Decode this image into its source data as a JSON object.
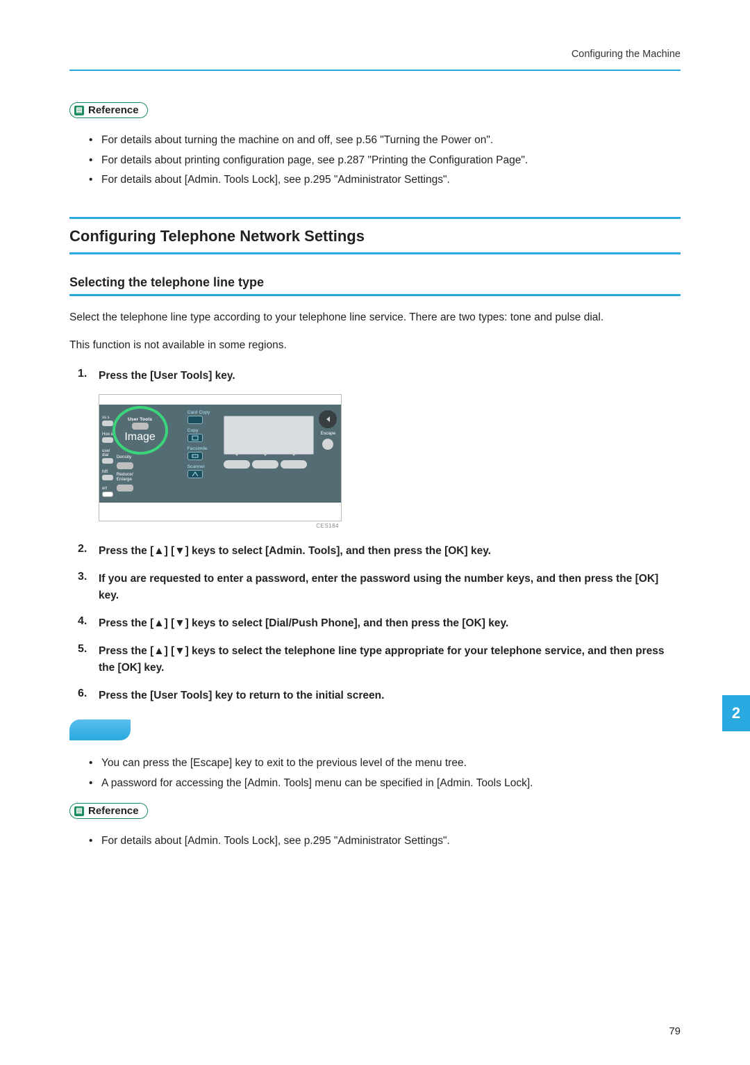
{
  "header": {
    "running": "Configuring the Machine"
  },
  "reference_label": "Reference",
  "ref_list_1": [
    "For details about turning the machine on and off, see p.56 \"Turning the Power on\".",
    "For details about printing configuration page, see p.287 \"Printing the Configuration Page\".",
    "For details about [Admin. Tools Lock], see p.295 \"Administrator Settings\"."
  ],
  "section_heading": "Configuring Telephone Network Settings",
  "sub_heading": "Selecting the telephone line type",
  "para1": "Select the telephone line type according to your telephone line service. There are two types: tone and pulse dial.",
  "para2": "This function is not available in some regions.",
  "steps": [
    {
      "main": "Press the [User Tools] key."
    },
    {
      "main": "Press the [▲] [▼] keys to select [Admin. Tools], and then press the [OK] key."
    },
    {
      "main": "If you are requested to enter a password, enter the password using the number keys, and then press the [OK] key."
    },
    {
      "main": "Press the [▲] [▼] keys to select [Dial/Push Phone], and then press the [OK] key."
    },
    {
      "main": "Press the [▲] [▼] keys to select the telephone line type appropriate for your telephone service, and then press the [OK] key."
    },
    {
      "main": "Press the [User Tools] key to return to the initial screen."
    }
  ],
  "notes": [
    "You can press the [Escape] key to exit to the previous level of the menu tree.",
    "A password for accessing the [Admin. Tools] menu can be specified in [Admin. Tools Lock]."
  ],
  "ref_list_2": [
    "For details about [Admin. Tools Lock], see p.295 \"Administrator Settings\"."
  ],
  "panel": {
    "highlighted": "User Tools",
    "image_sub": "Image",
    "left_labels": [
      "ss s",
      "Hoo ial",
      "use/ dial",
      "hift",
      "ert"
    ],
    "mid_labels": {
      "density": "Density",
      "reduce": "Reduce/\nEnlarge"
    },
    "right_labels": [
      "Card Copy",
      "Copy",
      "Facsimile",
      "Scanner"
    ],
    "escape": "Escape",
    "caption": "CES184"
  },
  "page_number": "79",
  "side_tab": "2"
}
